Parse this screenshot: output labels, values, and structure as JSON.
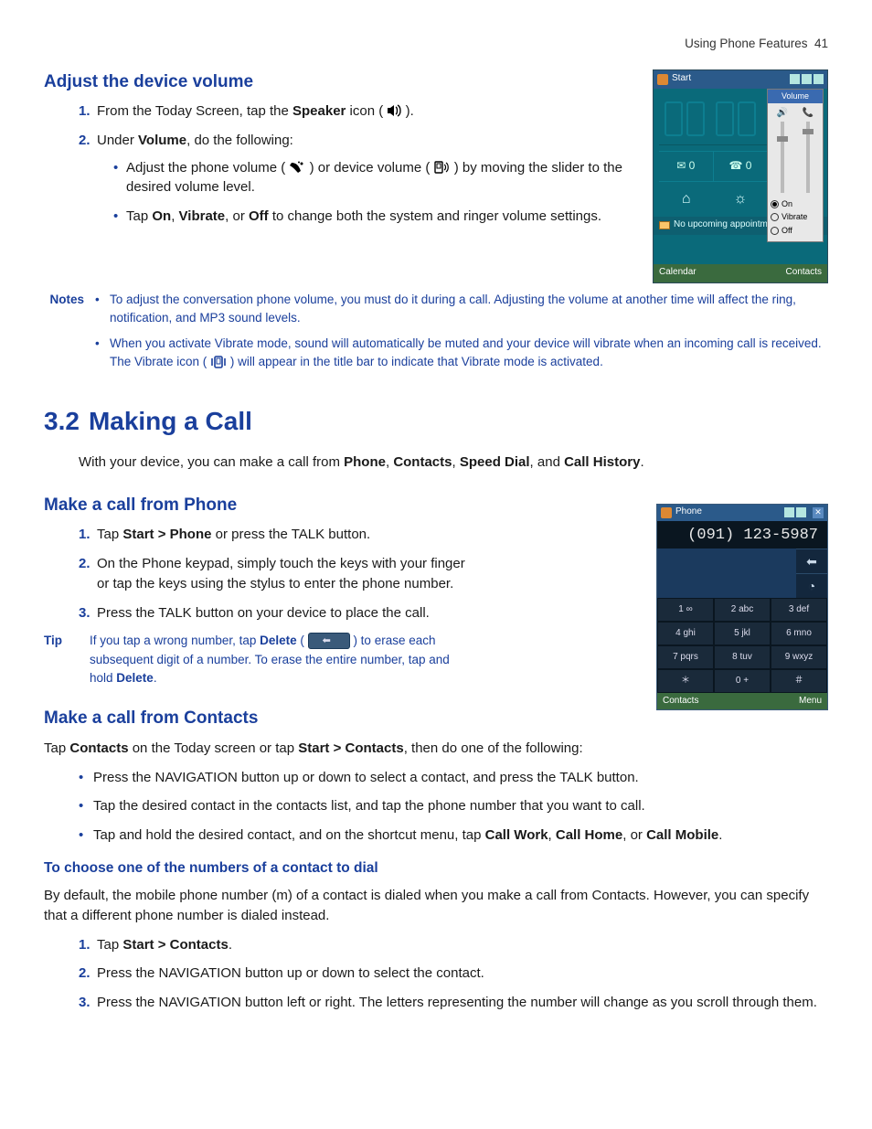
{
  "header": {
    "running": "Using Phone Features",
    "page": "41"
  },
  "s1": {
    "h": "Adjust the device volume",
    "step1_a": "From the Today Screen, tap the ",
    "step1_b": "Speaker",
    "step1_c": " icon (",
    "step1_d": " ).",
    "step2_a": "Under ",
    "step2_b": "Volume",
    "step2_c": ", do the following:",
    "sub1_a": "Adjust the phone volume (",
    "sub1_b": " ) or device volume (",
    "sub1_c": " ) by moving the slider to the desired volume level.",
    "sub2_a": "Tap ",
    "sub2_b": "On",
    "sub2_c": ", ",
    "sub2_d": "Vibrate",
    "sub2_e": ", or ",
    "sub2_f": "Off",
    "sub2_g": " to change both the system and ringer volume settings."
  },
  "shot1": {
    "start": "Start",
    "appt": "No upcoming appointm",
    "soft_l": "Calendar",
    "soft_r": "Contacts",
    "vol_h": "Volume",
    "on": "On",
    "vib": "Vibrate",
    "off": "Off"
  },
  "notes": {
    "label": "Notes",
    "n1": "To adjust the conversation phone volume, you must do it during a call. Adjusting the volume at another time will affect the ring, notification, and MP3 sound levels.",
    "n2_a": "When you activate Vibrate mode, sound will automatically be muted and your device will vibrate when an incoming call is received. The Vibrate icon (",
    "n2_b": " ) will appear in the title bar to indicate that Vibrate mode is activated."
  },
  "s2": {
    "num": "3.2",
    "h": "Making a Call",
    "intro_a": "With your device, you can make a call from ",
    "intro_b": "Phone",
    "intro_c": ", ",
    "intro_d": "Contacts",
    "intro_e": ", ",
    "intro_f": "Speed Dial",
    "intro_g": ", and ",
    "intro_h": "Call History",
    "intro_i": "."
  },
  "s3": {
    "h": "Make a call from Phone",
    "step1_a": "Tap ",
    "step1_b": "Start > Phone",
    "step1_c": " or press the TALK button.",
    "step2": "On the Phone keypad, simply touch the keys with your finger or tap the keys using the stylus to enter the phone number.",
    "step3": "Press the TALK button on your device to place the call."
  },
  "tip": {
    "label": "Tip",
    "a": "If you tap a wrong number, tap ",
    "b": "Delete",
    "c": " (",
    "d": " ) to erase each subsequent digit of a number. To erase the entire number, tap and hold ",
    "e": "Delete",
    "f": "."
  },
  "shot2": {
    "title": "Phone",
    "num": "(091) 123-5987",
    "k": [
      "1 ∞",
      "2 abc",
      "3 def",
      "4 ghi",
      "5 jkl",
      "6 mno",
      "7 pqrs",
      "8 tuv",
      "9 wxyz",
      "＊",
      "0 +",
      "＃"
    ],
    "soft_l": "Contacts",
    "soft_r": "Menu"
  },
  "s4": {
    "h": "Make a call from Contacts",
    "intro_a": "Tap ",
    "intro_b": "Contacts",
    "intro_c": " on the Today screen or tap ",
    "intro_d": "Start > Contacts",
    "intro_e": ", then do one of the following:",
    "b1": "Press the NAVIGATION button up or down to select a contact, and press the TALK button.",
    "b2": "Tap the desired contact in the contacts list, and tap the phone number that you want to call.",
    "b3_a": "Tap and hold the desired contact, and on the shortcut menu, tap ",
    "b3_b": "Call Work",
    "b3_c": ", ",
    "b3_d": "Call Home",
    "b3_e": ", or ",
    "b3_f": "Call Mobile",
    "b3_g": "."
  },
  "s5": {
    "h": "To choose one of the numbers of a contact to dial",
    "intro": "By default, the mobile phone number (m) of a contact is dialed when you make a call from Contacts. However, you can specify that a different phone number is dialed instead.",
    "step1_a": "Tap ",
    "step1_b": "Start > Contacts",
    "step1_c": ".",
    "step2": "Press the NAVIGATION button up or down to select the contact.",
    "step3": "Press the NAVIGATION button left or right. The letters representing the number will change as you scroll through them."
  }
}
